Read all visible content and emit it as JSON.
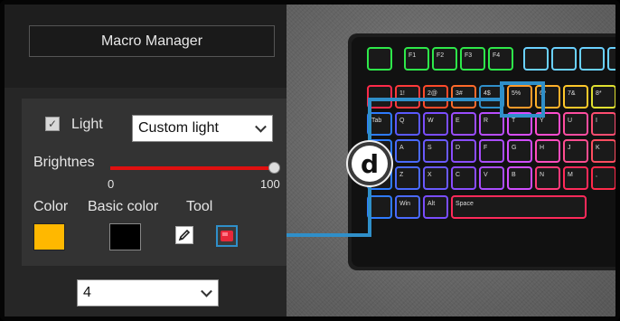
{
  "macro": {
    "button_label": "Macro Manager"
  },
  "light": {
    "checkbox_checked": true,
    "checkbox_glyph": "✓",
    "label": "Light",
    "mode_select_value": "Custom light"
  },
  "brightness": {
    "label": "Brightnes",
    "min_label": "0",
    "max_label": "100",
    "value_fraction": 1.0,
    "track_color": "#e01010"
  },
  "color_tools": {
    "color_label": "Color",
    "basic_color_label": "Basic color",
    "tool_label": "Tool",
    "color_swatch": "#ffb800",
    "basic_color_swatch": "#000000",
    "tools": [
      {
        "name": "pencil-icon",
        "selected": false
      },
      {
        "name": "fill-icon",
        "selected": true
      }
    ]
  },
  "profile_select": {
    "value": "4"
  },
  "callout": {
    "badge_letter": "d",
    "accent_color": "#2f8fc9"
  },
  "keyboard": {
    "rows": [
      {
        "keys": [
          "",
          "F1",
          "F2",
          "F3",
          "F4",
          "",
          "",
          "",
          ""
        ]
      },
      {
        "keys": [
          "",
          "1!",
          "2@",
          "3#",
          "4$",
          "5%",
          "6^",
          "7&",
          "8*"
        ]
      },
      {
        "keys": [
          "Tab",
          "Q",
          "W",
          "E",
          "R",
          "T",
          "Y",
          "U",
          "I"
        ]
      },
      {
        "keys": [
          "",
          "A",
          "S",
          "D",
          "F",
          "G",
          "H",
          "J",
          "K"
        ]
      },
      {
        "keys": [
          "",
          "Z",
          "X",
          "C",
          "V",
          "B",
          "N",
          "M",
          ","
        ]
      },
      {
        "keys": [
          "",
          "Win",
          "Alt",
          "Space"
        ]
      }
    ]
  }
}
